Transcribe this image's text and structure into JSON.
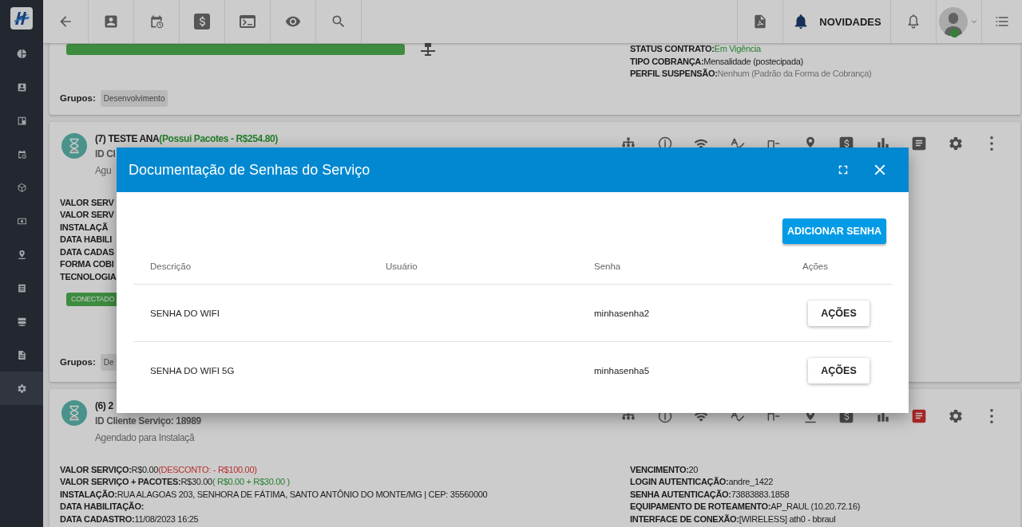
{
  "sidebar": {
    "items": [
      {
        "selected": false
      },
      {
        "selected": false
      },
      {
        "selected": false
      },
      {
        "selected": false
      },
      {
        "selected": false
      },
      {
        "selected": false
      },
      {
        "selected": false
      },
      {
        "selected": false
      },
      {
        "selected": false
      },
      {
        "selected": false
      },
      {
        "selected": true
      }
    ]
  },
  "topbar": {
    "news_label": "NOVIDADES",
    "user_online": true
  },
  "cards": [
    {
      "status_chip": {
        "connected": true,
        "network_icon": true
      },
      "right_fields": [
        {
          "label": "STATUS CONTRATO:",
          "value": "Em Vigência",
          "color": "#257e2e"
        },
        {
          "label": "TIPO COBRANÇA:",
          "value": "Mensalidade (postecipada)"
        },
        {
          "label": "PERFIL SUSPENSÃO:",
          "value": "Nenhum (Padrão da Forma de Cobrança)",
          "color": "#6d6d6d"
        }
      ],
      "groups": {
        "label": "Grupos:",
        "tags": [
          "Desenvolvimento"
        ]
      }
    },
    {
      "header": {
        "title": "(7) TESTE ANA",
        "title_note": "(Possui Pacotes - R$254.80)",
        "id_line": "ID Cl",
        "status_text": "Agu"
      },
      "notes_flagged": false,
      "left_fields": [
        {
          "label": "VALOR SERV"
        },
        {
          "label": "VALOR SERV"
        },
        {
          "label": "INSTALAÇÃ"
        },
        {
          "label": "DATA HABILI"
        },
        {
          "label": "DATA CADAS"
        },
        {
          "label": "FORMA COBI"
        },
        {
          "label": "TECNOLOGIA"
        }
      ],
      "status_chip": {
        "label": "CONECTADO",
        "connected": true
      },
      "groups": {
        "label": "Grupos:",
        "tags": [
          "De"
        ]
      }
    },
    {
      "header": {
        "title": "(6) 2",
        "id_line": "ID Cliente Serviço: 18989",
        "status_text": "Agendado para Instalaçã"
      },
      "notes_flagged": true,
      "left_fields": [
        {
          "label": "VALOR SERVIÇO:",
          "value": "R$0.00",
          "note": {
            "text": "(DESCONTO: - R$100.00)",
            "color": "#b72e2b"
          }
        },
        {
          "label": "VALOR SERVIÇO + PACOTES:",
          "value": "R$30.00",
          "note": {
            "text": "( R$0.00 + R$30.00 )",
            "color": "#257e2e"
          }
        },
        {
          "label": "INSTALAÇÃO:",
          "value": "RUA ALAGOAS 203, SENHORA DE FÁTIMA, SANTO ANTÔNIO DO MONTE/MG | CEP: 35560000"
        },
        {
          "label": "DATA HABILITAÇÃO:"
        },
        {
          "label": "DATA CADASTRO:",
          "value": "11/08/2023 16:25"
        }
      ],
      "right_fields": [
        {
          "label": "VENCIMENTO:",
          "value": "20"
        },
        {
          "label": "LOGIN AUTENTICAÇÃO:",
          "value": "andre_1422"
        },
        {
          "label": "SENHA AUTENTICAÇÃO:",
          "value": "73883883.1858"
        },
        {
          "label": "EQUIPAMENTO DE ROTEAMENTO:",
          "value": "AP_RAUL (10.20.72.16)"
        },
        {
          "label": "INTERFACE DE CONEXÃO:",
          "value": "[WIRELESS] ath0 - bbraul"
        }
      ]
    }
  ],
  "modal": {
    "title": "Documentação de Senhas do Serviço",
    "add_button": "ADICIONAR SENHA",
    "columns": [
      "Descrição",
      "Usuário",
      "Senha",
      "Ações"
    ],
    "rows": [
      {
        "description": "SENHA DO WIFI",
        "password": "minhasenha2",
        "action": "AÇÕES"
      },
      {
        "description": "SENHA DO WIFI 5G",
        "password": "minhasenha5",
        "action": "AÇÕES"
      }
    ]
  }
}
